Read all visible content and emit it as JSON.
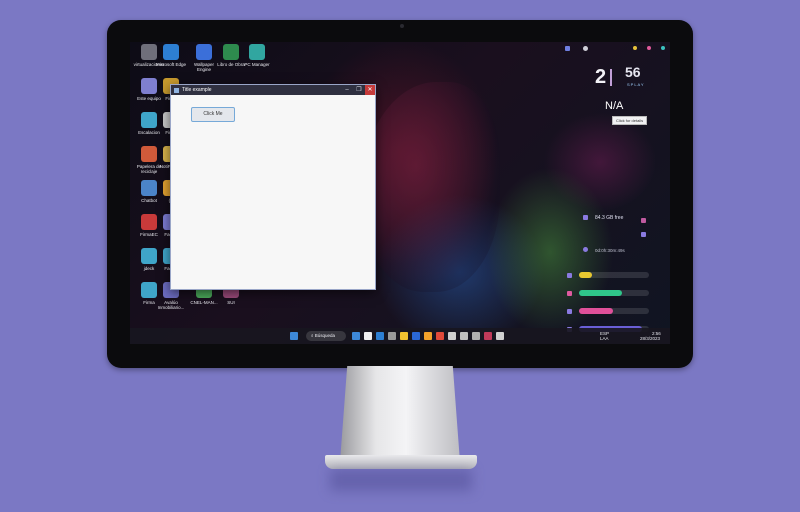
{
  "desktop_icons": [
    {
      "label": "virtualizaciones",
      "color": "#6f6f7a"
    },
    {
      "label": "Microsoft Edge",
      "color": "#2d7fd3"
    },
    {
      "label": "Wallpaper Engine",
      "color": "#3b6fd9"
    },
    {
      "label": "Libro de Obra",
      "color": "#2e8b4e"
    },
    {
      "label": "PC Manager",
      "color": "#31a6a0"
    },
    {
      "label": "Este equipo",
      "color": "#7f7fd0"
    },
    {
      "label": "Finan",
      "color": "#c79a2e"
    },
    {
      "label": "Escalacion",
      "color": "#3fa5c9"
    },
    {
      "label": "Finan",
      "color": "#c7c7c7"
    },
    {
      "label": "Papelera de reciclaje",
      "color": "#d05a3a"
    },
    {
      "label": "NotiF Conv",
      "color": "#d6b24a"
    },
    {
      "label": "Chatbot",
      "color": "#4b84c9"
    },
    {
      "label": "(C",
      "color": "#e0a030"
    },
    {
      "label": "FirmaEC",
      "color": "#c83a3a"
    },
    {
      "label": "Fact C",
      "color": "#7a7ad0"
    },
    {
      "label": "jdeck",
      "color": "#3fa5c9"
    },
    {
      "label": "Fact C",
      "color": "#3fa5c9"
    },
    {
      "label": "Firma",
      "color": "#3fa5c9"
    },
    {
      "label": "Avalúo Inmobiliario...",
      "color": "#6c6cc0"
    },
    {
      "label": "CNEL-MAN...",
      "color": "#4aa85a"
    },
    {
      "label": "SUI",
      "color": "#9a4a7a"
    }
  ],
  "window": {
    "title": "Title example",
    "button_label": "Click Me",
    "minimize_glyph": "–",
    "maximize_glyph": "❐",
    "close_glyph": "✕"
  },
  "widgets": {
    "time_hour": "2",
    "time_minutes": "56",
    "brand": "SPLAY",
    "weather": "N/A",
    "weather_tooltip": "Click for details",
    "disk_free": "84.3 GB free",
    "uptime": "0d:0h:30m:49s",
    "bars": [
      {
        "name": "cpu",
        "fraction": 0.18,
        "color": "#e8c930",
        "icon_color": "#8a7ae0"
      },
      {
        "name": "ram",
        "fraction": 0.62,
        "color": "#2fc58a",
        "icon_color": "#e05aa0"
      },
      {
        "name": "disk",
        "fraction": 0.48,
        "color": "#e0509a",
        "icon_color": "#8a7ae0"
      },
      {
        "name": "net",
        "fraction": 0.9,
        "color": "#6a5fd6",
        "icon_color": "#8a7ae0"
      }
    ],
    "accent_dots": [
      "#e7c13a",
      "#e05a9a",
      "#3bc2c0"
    ]
  },
  "taskbar": {
    "search_label": "Búsqueda",
    "lang_top": "ESP",
    "lang_bottom": "LAA",
    "clock_time": "2:56",
    "clock_date": "28/3/2023",
    "items": [
      "#3d88d8",
      "#f0f0f0",
      "#2d7fd3",
      "#9a9a9a",
      "#f2c230",
      "#2b68d6",
      "#f2a12a",
      "#e04a3a",
      "#d0d0d0",
      "#c0c0c0",
      "#b0b0b0",
      "#c03a5a",
      "#d0d0d0"
    ]
  }
}
